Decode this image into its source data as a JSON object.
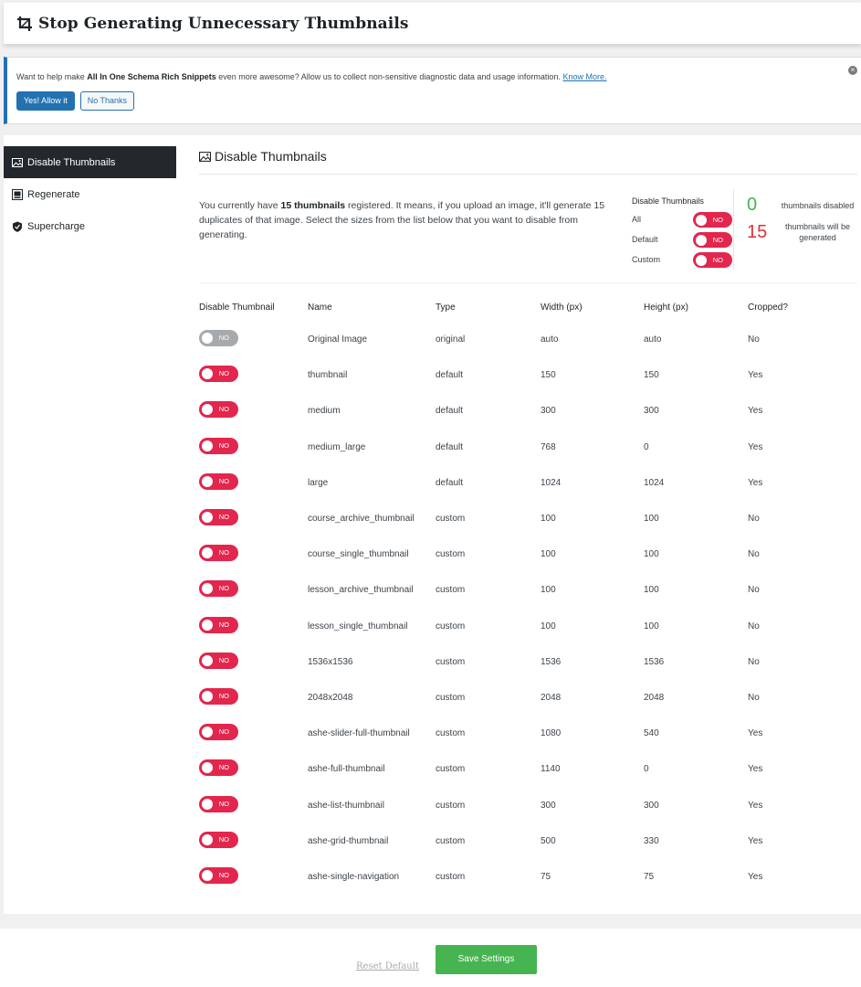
{
  "header": {
    "title": "Stop Generating Unnecessary Thumbnails",
    "icon": "crop-icon"
  },
  "notice": {
    "text_before": "Want to help make ",
    "plugin_name": "All In One Schema Rich Snippets",
    "text_after": " even more awesome? Allow us to collect non-sensitive diagnostic data and usage information. ",
    "link": "Know More.",
    "allow_button": "Yes! Allow it",
    "decline_button": "No Thanks",
    "dismiss": "×"
  },
  "sidebar": {
    "items": [
      {
        "label": "Disable Thumbnails",
        "icon": "image-icon",
        "active": true
      },
      {
        "label": "Regenerate",
        "icon": "regenerate-icon",
        "active": false
      },
      {
        "label": "Supercharge",
        "icon": "shield-icon",
        "active": false
      }
    ]
  },
  "section": {
    "title": "Disable Thumbnails",
    "desc_part1": "You currently have ",
    "desc_bold": "15 thumbnails",
    "desc_part2": " registered. It means, if you upload an image, it'll generate 15 duplicates of that image. Select the sizes from the list below that you want to disable from generating."
  },
  "quick": {
    "title": "Disable Thumbnails",
    "rows": [
      {
        "label": "All",
        "toggle": "NO"
      },
      {
        "label": "Default",
        "toggle": "NO"
      },
      {
        "label": "Custom",
        "toggle": "NO"
      }
    ]
  },
  "stats": {
    "disabled_count": "0",
    "disabled_label": "thumbnails disabled",
    "generated_count": "15",
    "generated_label": "thumbnails will be generated"
  },
  "table": {
    "headers": [
      "Disable Thumbnail",
      "Name",
      "Type",
      "Width (px)",
      "Height (px)",
      "Cropped?"
    ],
    "rows": [
      {
        "toggle": "NO",
        "name": "Original Image",
        "type": "original",
        "width": "auto",
        "height": "auto",
        "cropped": "No",
        "disabled": true
      },
      {
        "toggle": "NO",
        "name": "thumbnail",
        "type": "default",
        "width": "150",
        "height": "150",
        "cropped": "Yes"
      },
      {
        "toggle": "NO",
        "name": "medium",
        "type": "default",
        "width": "300",
        "height": "300",
        "cropped": "Yes"
      },
      {
        "toggle": "NO",
        "name": "medium_large",
        "type": "default",
        "width": "768",
        "height": "0",
        "cropped": "Yes"
      },
      {
        "toggle": "NO",
        "name": "large",
        "type": "default",
        "width": "1024",
        "height": "1024",
        "cropped": "Yes"
      },
      {
        "toggle": "NO",
        "name": "course_archive_thumbnail",
        "type": "custom",
        "width": "100",
        "height": "100",
        "cropped": "No"
      },
      {
        "toggle": "NO",
        "name": "course_single_thumbnail",
        "type": "custom",
        "width": "100",
        "height": "100",
        "cropped": "No"
      },
      {
        "toggle": "NO",
        "name": "lesson_archive_thumbnail",
        "type": "custom",
        "width": "100",
        "height": "100",
        "cropped": "No"
      },
      {
        "toggle": "NO",
        "name": "lesson_single_thumbnail",
        "type": "custom",
        "width": "100",
        "height": "100",
        "cropped": "No"
      },
      {
        "toggle": "NO",
        "name": "1536x1536",
        "type": "custom",
        "width": "1536",
        "height": "1536",
        "cropped": "No"
      },
      {
        "toggle": "NO",
        "name": "2048x2048",
        "type": "custom",
        "width": "2048",
        "height": "2048",
        "cropped": "No"
      },
      {
        "toggle": "NO",
        "name": "ashe-slider-full-thumbnail",
        "type": "custom",
        "width": "1080",
        "height": "540",
        "cropped": "Yes"
      },
      {
        "toggle": "NO",
        "name": "ashe-full-thumbnail",
        "type": "custom",
        "width": "1140",
        "height": "0",
        "cropped": "Yes"
      },
      {
        "toggle": "NO",
        "name": "ashe-list-thumbnail",
        "type": "custom",
        "width": "300",
        "height": "300",
        "cropped": "Yes"
      },
      {
        "toggle": "NO",
        "name": "ashe-grid-thumbnail",
        "type": "custom",
        "width": "500",
        "height": "330",
        "cropped": "Yes"
      },
      {
        "toggle": "NO",
        "name": "ashe-single-navigation",
        "type": "custom",
        "width": "75",
        "height": "75",
        "cropped": "Yes"
      }
    ]
  },
  "footer": {
    "reset": "Reset Default",
    "save": "Save Settings"
  },
  "colors": {
    "toggle_red": "#e2264d",
    "toggle_grey": "#a7aaad",
    "save_green": "#46b450",
    "primary_blue": "#2271b1",
    "active_dark": "#23282d"
  }
}
